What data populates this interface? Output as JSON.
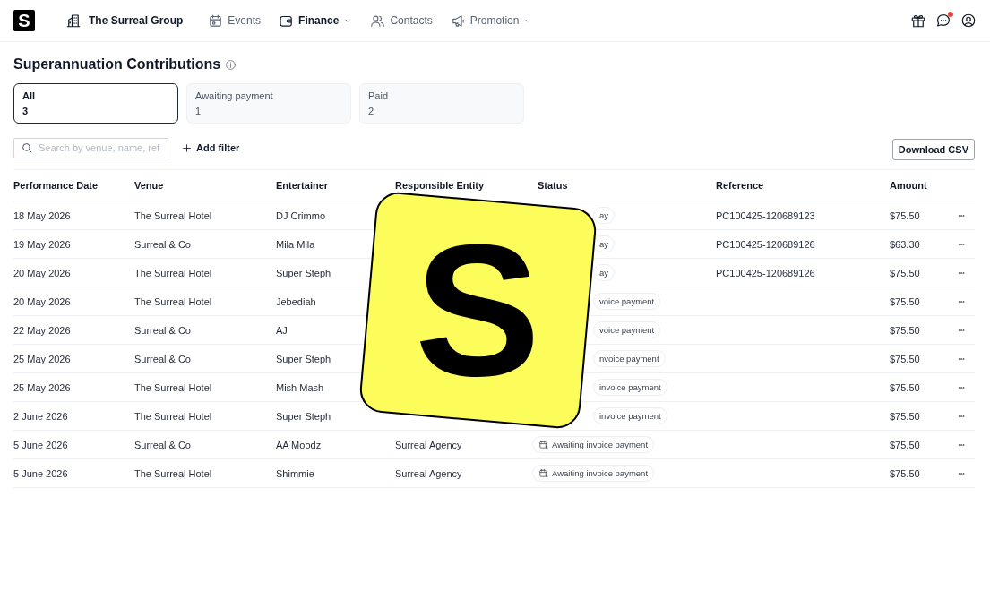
{
  "logo": {
    "mark": "S"
  },
  "nav": {
    "org": "The Surreal Group",
    "items": [
      {
        "label": "Events",
        "dropdown": false,
        "selected": false
      },
      {
        "label": "Finance",
        "dropdown": true,
        "selected": true
      },
      {
        "label": "Contacts",
        "dropdown": false,
        "selected": false
      },
      {
        "label": "Promotion",
        "dropdown": true,
        "selected": false
      }
    ],
    "messages_unread": true
  },
  "page": {
    "title": "Superannuation Contributions"
  },
  "tabs": [
    {
      "label": "All",
      "count": "3",
      "selected": true
    },
    {
      "label": "Awaiting payment",
      "count": "1",
      "selected": false
    },
    {
      "label": "Paid",
      "count": "2",
      "selected": false
    }
  ],
  "search": {
    "placeholder": "Search by venue, name, ref"
  },
  "add_filter": "Add filter",
  "download": "Download CSV",
  "table": {
    "columns": [
      "Performance Date",
      "Venue",
      "Entertainer",
      "Responsible Entity",
      "Status",
      "Reference",
      "Amount"
    ],
    "rows": [
      {
        "date": "18 May 2026",
        "venue": "The Surreal Hotel",
        "entertainer": "DJ Crimmo",
        "status": "ay",
        "reference": "PC100425-120689123",
        "amount": "$75.50"
      },
      {
        "date": "19 May 2026",
        "venue": "Surreal & Co",
        "entertainer": "Mila Mila",
        "status": "ay",
        "reference": "PC100425-120689126",
        "amount": "$63.30"
      },
      {
        "date": "20 May 2026",
        "venue": "The Surreal Hotel",
        "entertainer": "Super Steph",
        "status": "ay",
        "reference": "PC100425-120689126",
        "amount": "$75.50"
      },
      {
        "date": "20 May 2026",
        "venue": "The Surreal Hotel",
        "entertainer": "Jebediah",
        "status": "voice payment",
        "amount": "$75.50"
      },
      {
        "date": "22 May 2026",
        "venue": "Surreal & Co",
        "entertainer": "AJ",
        "status": "voice payment",
        "amount": "$75.50"
      },
      {
        "date": "25 May 2026",
        "venue": "Surreal & Co",
        "entertainer": "Super Steph",
        "status": "nvoice payment",
        "amount": "$75.50"
      },
      {
        "date": "25 May 2026",
        "venue": "The Surreal Hotel",
        "entertainer": "Mish Mash",
        "status": "invoice payment",
        "amount": "$75.50"
      },
      {
        "date": "2 June 2026",
        "venue": "The Surreal Hotel",
        "entertainer": "Super Steph",
        "status": "invoice payment",
        "amount": "$75.50"
      },
      {
        "date": "5 June 2026",
        "venue": "Surreal & Co",
        "entertainer": "AA Moodz",
        "entity": "Surreal Agency",
        "status": "Awaiting invoice payment",
        "status_icon": true,
        "amount": "$75.50"
      },
      {
        "date": "5 June 2026",
        "venue": "The Surreal Hotel",
        "entertainer": "Shimmie",
        "entity": "Surreal Agency",
        "status": "Awaiting invoice payment",
        "status_icon": true,
        "amount": "$75.50"
      }
    ]
  },
  "sticker": {
    "mark": "S"
  }
}
